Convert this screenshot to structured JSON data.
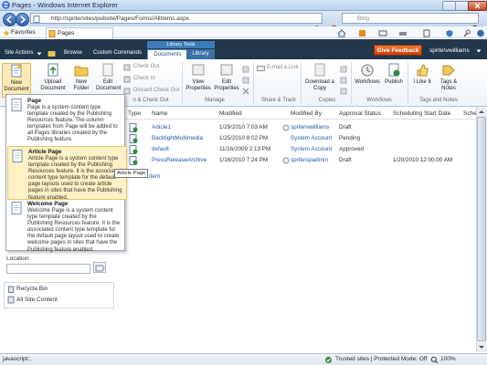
{
  "window": {
    "title": "Pages - Windows Internet Explorer"
  },
  "address_bar": {
    "url": "http://sprite/sites/pubsite/Pages/Forms/AllItems.aspx",
    "search_placeholder": "Bing"
  },
  "favorites_bar": {
    "favorites_label": "Favorites",
    "tab_label": "Pages"
  },
  "sp_nav": {
    "site_actions": "Site Actions",
    "browse": "Browse",
    "custom_commands": "Custom Commands",
    "library_tools": "Library Tools",
    "documents_tab": "Documents",
    "library_tab": "Library",
    "give_feedback": "Give Feedback",
    "user": "sprite\\vwilliams"
  },
  "ribbon": {
    "new_document": "New Document",
    "upload_document": "Upload Document",
    "new_folder": "New Folder",
    "edit_document": "Edit Document",
    "check_out": "Check Out",
    "check_in": "Check In",
    "discard_check_out": "Discard Check Out",
    "view_properties": "View Properties",
    "edit_properties": "Edit Properties",
    "email_link": "E-mail a Link",
    "download_copy": "Download a Copy",
    "workflows": "Workflows",
    "publish": "Publish",
    "i_like_it": "I Like It",
    "tags_notes": "Tags & Notes",
    "groups": {
      "open_check_out": "n & Check Out",
      "manage": "Manage",
      "share_track": "Share & Track",
      "copies": "Copies",
      "workflows": "Workflows",
      "tags_notes": "Tags and Notes"
    }
  },
  "new_document_menu": [
    {
      "title": "Page",
      "desc": "Page is a system content type template created by the Publishing Resources feature. The column templates from Page will be added to all Pages libraries created by the Publishing feature."
    },
    {
      "title": "Article Page",
      "desc": "Article Page is a system content type template created by the Publishing Resources feature. It is the associated content type template for the default page layouts used to create article pages in sites that have the Publishing feature enabled."
    },
    {
      "title": "Welcome Page",
      "desc": "Welcome Page is a system content type template created by the Publishing Resources feature. It is the associated content type template for the default page layout used to create welcome pages in sites that have the Publishing feature enabled."
    }
  ],
  "tooltip": "Article Page",
  "list": {
    "columns": [
      "Type",
      "Name",
      "Modified",
      "Modified By",
      "Approval Status",
      "Scheduling Start Date",
      "Sche"
    ],
    "rows": [
      {
        "name": "Article1",
        "modified": "1/29/2010 7:03 AM",
        "modified_by": "sprite\\vwilliams",
        "status": "Draft",
        "start": ""
      },
      {
        "name": "BacklightMultimedia",
        "modified": "1/25/2010 8:02 PM",
        "modified_by": "System Account",
        "status": "Pending",
        "start": ""
      },
      {
        "name": "default",
        "modified": "11/16/2009 2:13 PM",
        "modified_by": "System Account",
        "status": "Approved",
        "start": ""
      },
      {
        "name": "PressReleaseArchive",
        "modified": "1/16/2010 7:24 PM",
        "modified_by": "sprite\\spadmin",
        "status": "Draft",
        "start": "1/20/2010 12:00:00 AM"
      }
    ],
    "add_item": "Add new item"
  },
  "left_nav": {
    "location_label": "Location",
    "recycle_bin": "Recycle Bin",
    "all_site_content": "All Site Content"
  },
  "status_bar": {
    "left": "javascript:;",
    "zone": "Trusted sites | Protected Mode: Off",
    "zoom": "100%"
  }
}
